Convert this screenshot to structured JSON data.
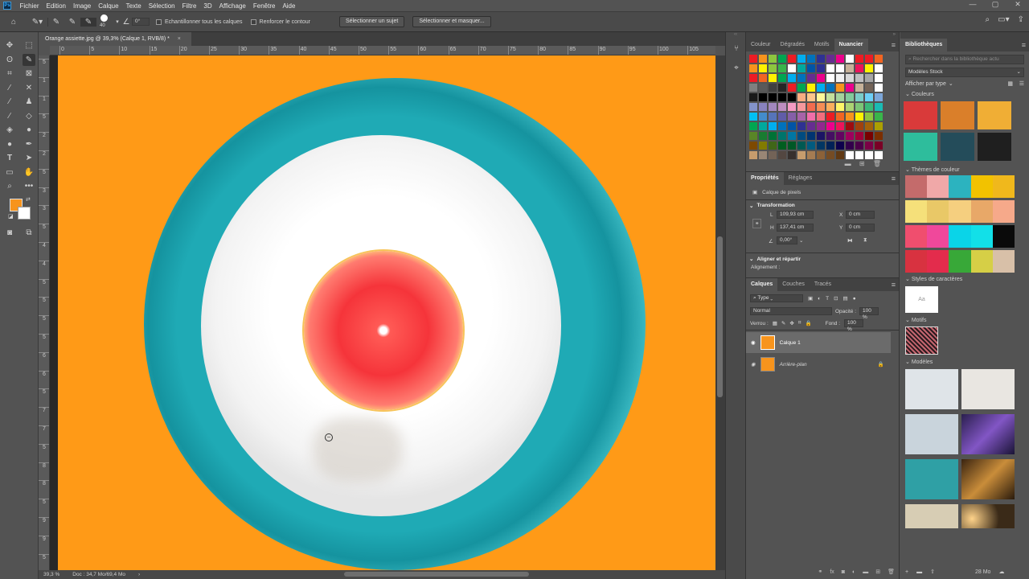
{
  "app": {
    "logo": "Ps"
  },
  "menu": [
    "Fichier",
    "Edition",
    "Image",
    "Calque",
    "Texte",
    "Sélection",
    "Filtre",
    "3D",
    "Affichage",
    "Fenêtre",
    "Aide"
  ],
  "options": {
    "brush_size": "40",
    "angle": "0°",
    "sample_all": "Echantillonner tous les calques",
    "enhance_edge": "Renforcer le contour",
    "select_subject": "Sélectionner un sujet",
    "select_mask": "Sélectionner et masquer..."
  },
  "document": {
    "tab_title": "Orange assiette.jpg @ 39,3% (Calque 1, RVB/8) *",
    "close": "×",
    "zoom": "39,3 %",
    "doc_info": "Doc : 34,7 Mo/69,4 Mo",
    "status_arrow": "›"
  },
  "ruler": {
    "top": [
      "0",
      "5",
      "10",
      "15",
      "20",
      "25",
      "30",
      "35",
      "40",
      "45",
      "50",
      "55",
      "60",
      "65",
      "70",
      "75",
      "80",
      "85",
      "90",
      "95",
      "100",
      "105"
    ],
    "left": [
      "5",
      "1",
      "1",
      "5",
      "2",
      "2",
      "5",
      "3",
      "3",
      "5",
      "4",
      "4",
      "5",
      "5",
      "5",
      "5",
      "6",
      "6",
      "5",
      "7",
      "7",
      "5",
      "8",
      "8",
      "5",
      "9",
      "9",
      "5"
    ]
  },
  "swatch_panel": {
    "tabs": [
      "Couleur",
      "Dégradés",
      "Motifs",
      "Nuancier"
    ],
    "active": "Nuancier",
    "colors": [
      "#ed1c24",
      "#f7941d",
      "#8dc63f",
      "#00a651",
      "#ed1c24",
      "#00aeef",
      "#0072bc",
      "#2e3192",
      "#662d91",
      "#ec008c",
      "#ffffff",
      "#ed1c24",
      "#ed1c24",
      "#f26522",
      "#f7941d",
      "#fff200",
      "#8dc63f",
      "#39b54a",
      "#ffffff",
      "#00a99d",
      "#0054a6",
      "#2e3192",
      "#ffffff",
      "#ffffff",
      "#c7b299",
      "#ed145b",
      "#fff200",
      "#ffffff",
      "#ed1c24",
      "#f26522",
      "#fff200",
      "#00a651",
      "#00aeef",
      "#0072bc",
      "#662d91",
      "#ec008c",
      "#ffffff",
      "#f2f2f2",
      "#d9d9d9",
      "#bfbfbf",
      "#a6a6a6",
      "#ffffff",
      "#7f7f7f",
      "#595959",
      "#404040",
      "#262626",
      "#ed1c24",
      "#00a651",
      "#fff200",
      "#00aeef",
      "#0072bc",
      "#f7941d",
      "#ec008c",
      "#c7b299",
      "#736357",
      "#ffffff",
      "#1a1a1a",
      "#000000",
      "#000000",
      "#000000",
      "#000000",
      "#f9ad81",
      "#fdc68a",
      "#fff799",
      "#c4df9b",
      "#a3d39c",
      "#82ca9c",
      "#7accc8",
      "#6dcff6",
      "#7da7d9",
      "#8393ca",
      "#8882be",
      "#a187be",
      "#bc8dbf",
      "#f49ac2",
      "#f6989d",
      "#f26c4f",
      "#f68e56",
      "#fbaf5d",
      "#fff568",
      "#acd373",
      "#7cc576",
      "#3bb878",
      "#1abbb4",
      "#00bff3",
      "#438ccb",
      "#5674b9",
      "#605ca8",
      "#855fa8",
      "#a763a8",
      "#f06ea9",
      "#f26d7d",
      "#ed1c24",
      "#f26522",
      "#f7941d",
      "#fff200",
      "#8dc63f",
      "#39b54a",
      "#00a651",
      "#00a99d",
      "#00aeef",
      "#0072bc",
      "#0054a6",
      "#2e3192",
      "#662d91",
      "#92278f",
      "#ec008c",
      "#ed145b",
      "#9e0b0f",
      "#a0410d",
      "#a36209",
      "#aba000",
      "#598527",
      "#197b30",
      "#007236",
      "#00746b",
      "#0076a3",
      "#004b80",
      "#003471",
      "#1b1464",
      "#440e62",
      "#630460",
      "#9e005d",
      "#9e0039",
      "#790000",
      "#7b2e00",
      "#7d4900",
      "#827b00",
      "#406618",
      "#005e20",
      "#005826",
      "#005952",
      "#005b7f",
      "#003663",
      "#002157",
      "#0d004c",
      "#32004b",
      "#4b0049",
      "#7b0046",
      "#7a0026",
      "#c69c6d",
      "#998675",
      "#736357",
      "#534741",
      "#37302d",
      "#c69c6d",
      "#a67c52",
      "#8c6239",
      "#754c24",
      "#603913",
      "#ffffff",
      "#ffffff",
      "#ffffff",
      "#ffffff"
    ]
  },
  "properties": {
    "tabs": [
      "Propriétés",
      "Réglages"
    ],
    "layer_type": "Calque de pixels",
    "transform_title": "Transformation",
    "w_label": "L",
    "w_value": "109,93 cm",
    "h_label": "H",
    "h_value": "137,41 cm",
    "x_label": "X",
    "x_value": "0 cm",
    "y_label": "Y",
    "y_value": "0 cm",
    "angle_value": "0,00°",
    "align_title": "Aligner et répartir",
    "align_label": "Alignement :"
  },
  "layers": {
    "tabs": [
      "Calques",
      "Couches",
      "Tracés"
    ],
    "filter": "Type",
    "blend": "Normal",
    "opacity_label": "Opacité :",
    "opacity": "100 %",
    "lock_label": "Verrou :",
    "fill_label": "Fond :",
    "fill": "100 %",
    "items": [
      {
        "name": "Calque 1",
        "selected": true
      },
      {
        "name": "Arrière-plan",
        "selected": false
      }
    ]
  },
  "libraries": {
    "title": "Bibliothèques",
    "search_placeholder": "Rechercher dans la bibliothèque actu",
    "dropdown": "Modèles Stock",
    "view_by": "Afficher par type",
    "sections": {
      "colors": "Couleurs",
      "themes": "Thèmes de couleur",
      "char_styles": "Styles de caractères",
      "patterns": "Motifs",
      "templates": "Modèles"
    },
    "colors": [
      "#d93a3a",
      "#da7f2a",
      "#f0ae35",
      "#2ebd9c",
      "#244c5a",
      "#1f1f1f"
    ],
    "themes": [
      [
        "#c46b6b",
        "#f0a8a8",
        "#2cb3bf",
        "#f2c200",
        "#f0b81c"
      ],
      [
        "#f5e07a",
        "#e9c867",
        "#f5cf7f",
        "#e8a868",
        "#f6a98a"
      ],
      [
        "#f04e6e",
        "#f0489b",
        "#0ad4e8",
        "#12e0e8",
        "#0a0a0a"
      ],
      [
        "#d83240",
        "#e32c4c",
        "#38a838",
        "#d6cf46",
        "#d8c0a8"
      ]
    ],
    "char_style_sample": "Aa",
    "storage": "28 Mo"
  }
}
